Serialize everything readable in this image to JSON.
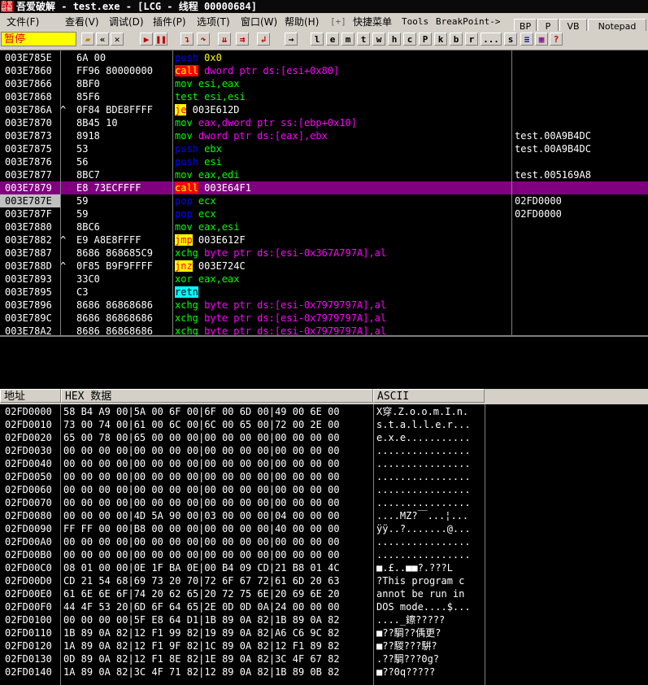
{
  "window": {
    "app_name": "吾爱破解",
    "title_rest": " - test.exe - [LCG - 线程 00000684]"
  },
  "menu": {
    "items": [
      "文件(F)",
      "查看(V)",
      "调试(D)",
      "插件(P)",
      "选项(T)",
      "窗口(W)",
      "帮助(H)",
      "[+]",
      "快捷菜单",
      "Tools",
      "BreakPoint->"
    ],
    "right_buttons": [
      "BP",
      "P",
      "VB",
      "Notepad"
    ]
  },
  "toolbar": {
    "status": "暂停",
    "letter_buttons": [
      "l",
      "e",
      "m",
      "t",
      "w",
      "h",
      "c",
      "P",
      "k",
      "b",
      "r",
      "...",
      "s"
    ]
  },
  "disassembly": {
    "selected_index": 10,
    "rows": [
      {
        "addr": "003E785E",
        "mark": "",
        "hex": "6A 00",
        "mnem": "push",
        "ops": "0x0",
        "cmt": ""
      },
      {
        "addr": "003E7860",
        "mark": "",
        "hex": "FF96 80000000",
        "mnem": "call",
        "ops": "dword ptr ds:[esi+0x80]",
        "cmt": ""
      },
      {
        "addr": "003E7866",
        "mark": "",
        "hex": "8BF0",
        "mnem": "mov",
        "ops": "esi,eax",
        "cmt": ""
      },
      {
        "addr": "003E7868",
        "mark": "",
        "hex": "85F6",
        "mnem": "test",
        "ops": "esi,esi",
        "cmt": ""
      },
      {
        "addr": "003E786A",
        "mark": "^",
        "hex": "0F84 BDE8FFFF",
        "mnem": "je",
        "ops": "003E612D",
        "cmt": ""
      },
      {
        "addr": "003E7870",
        "mark": "",
        "hex": "8B45 10",
        "mnem": "mov",
        "ops": "eax,dword ptr ss:[ebp+0x10]",
        "cmt": ""
      },
      {
        "addr": "003E7873",
        "mark": "",
        "hex": "8918",
        "mnem": "mov",
        "ops": "dword ptr ds:[eax],ebx",
        "cmt": "test.00A9B4DC"
      },
      {
        "addr": "003E7875",
        "mark": "",
        "hex": "53",
        "mnem": "push",
        "ops": "ebx",
        "cmt": "test.00A9B4DC"
      },
      {
        "addr": "003E7876",
        "mark": "",
        "hex": "56",
        "mnem": "push",
        "ops": "esi",
        "cmt": ""
      },
      {
        "addr": "003E7877",
        "mark": "",
        "hex": "8BC7",
        "mnem": "mov",
        "ops": "eax,edi",
        "cmt": "test.005169A8"
      },
      {
        "addr": "003E7879",
        "mark": "",
        "hex": "E8 73ECFFFF",
        "mnem": "call",
        "ops": "003E64F1",
        "cmt": ""
      },
      {
        "addr": "003E787E",
        "mark": "",
        "hex": "59",
        "mnem": "pop",
        "ops": "ecx",
        "cmt": "02FD0000"
      },
      {
        "addr": "003E787F",
        "mark": "",
        "hex": "59",
        "mnem": "pop",
        "ops": "ecx",
        "cmt": "02FD0000"
      },
      {
        "addr": "003E7880",
        "mark": "",
        "hex": "8BC6",
        "mnem": "mov",
        "ops": "eax,esi",
        "cmt": ""
      },
      {
        "addr": "003E7882",
        "mark": "^",
        "hex": "E9 A8E8FFFF",
        "mnem": "jmp",
        "ops": "003E612F",
        "cmt": ""
      },
      {
        "addr": "003E7887",
        "mark": "",
        "hex": "8686 868685C9",
        "mnem": "xchg",
        "ops": "byte ptr ds:[esi-0x367A797A],al",
        "cmt": ""
      },
      {
        "addr": "003E788D",
        "mark": "^",
        "hex": "0F85 B9F9FFFF",
        "mnem": "jnz",
        "ops": "003E724C",
        "cmt": ""
      },
      {
        "addr": "003E7893",
        "mark": "",
        "hex": "33C0",
        "mnem": "xor",
        "ops": "eax,eax",
        "cmt": ""
      },
      {
        "addr": "003E7895",
        "mark": "",
        "hex": "C3",
        "mnem": "retn",
        "ops": "",
        "cmt": ""
      },
      {
        "addr": "003E7896",
        "mark": "",
        "hex": "8686 86868686",
        "mnem": "xchg",
        "ops": "byte ptr ds:[esi-0x7979797A],al",
        "cmt": ""
      },
      {
        "addr": "003E789C",
        "mark": "",
        "hex": "8686 86868686",
        "mnem": "xchg",
        "ops": "byte ptr ds:[esi-0x7979797A],al",
        "cmt": ""
      },
      {
        "addr": "003E78A2",
        "mark": "",
        "hex": "8686 86868686",
        "mnem": "xchg",
        "ops": "byte ptr ds:[esi-0x7979797A],al",
        "cmt": ""
      }
    ]
  },
  "dump": {
    "headers": [
      "地址",
      "HEX 数据",
      "ASCII"
    ],
    "rows": [
      {
        "addr": "02FD0000",
        "hex": "58 B4 A9 00|5A 00 6F 00|6F 00 6D 00|49 00 6E 00",
        "ascii": "X穿.Z.o.o.m.I.n."
      },
      {
        "addr": "02FD0010",
        "hex": "73 00 74 00|61 00 6C 00|6C 00 65 00|72 00 2E 00",
        "ascii": "s.t.a.l.l.e.r..."
      },
      {
        "addr": "02FD0020",
        "hex": "65 00 78 00|65 00 00 00|00 00 00 00|00 00 00 00",
        "ascii": "e.x.e..........."
      },
      {
        "addr": "02FD0030",
        "hex": "00 00 00 00|00 00 00 00|00 00 00 00|00 00 00 00",
        "ascii": "................"
      },
      {
        "addr": "02FD0040",
        "hex": "00 00 00 00|00 00 00 00|00 00 00 00|00 00 00 00",
        "ascii": "................"
      },
      {
        "addr": "02FD0050",
        "hex": "00 00 00 00|00 00 00 00|00 00 00 00|00 00 00 00",
        "ascii": "................"
      },
      {
        "addr": "02FD0060",
        "hex": "00 00 00 00|00 00 00 00|00 00 00 00|00 00 00 00",
        "ascii": "................"
      },
      {
        "addr": "02FD0070",
        "hex": "00 00 00 00|00 00 00 00|00 00 00 00|00 00 00 00",
        "ascii": "................"
      },
      {
        "addr": "02FD0080",
        "hex": "00 00 00 00|4D 5A 90 00|03 00 00 00|04 00 00 00",
        "ascii": "....MZ?￣...¦..."
      },
      {
        "addr": "02FD0090",
        "hex": "FF FF 00 00|B8 00 00 00|00 00 00 00|40 00 00 00",
        "ascii": "ÿÿ..?.......@..."
      },
      {
        "addr": "02FD00A0",
        "hex": "00 00 00 00|00 00 00 00|00 00 00 00|00 00 00 00",
        "ascii": "................"
      },
      {
        "addr": "02FD00B0",
        "hex": "00 00 00 00|00 00 00 00|00 00 00 00|00 00 00 00",
        "ascii": "................"
      },
      {
        "addr": "02FD00C0",
        "hex": "08 01 00 00|0E 1F BA 0E|00 B4 09 CD|21 B8 01 4C",
        "ascii": "■.£..■■?.???L"
      },
      {
        "addr": "02FD00D0",
        "hex": "CD 21 54 68|69 73 20 70|72 6F 67 72|61 6D 20 63",
        "ascii": "?This program c"
      },
      {
        "addr": "02FD00E0",
        "hex": "61 6E 6E 6F|74 20 62 65|20 72 75 6E|20 69 6E 20",
        "ascii": "annot be run in "
      },
      {
        "addr": "02FD00F0",
        "hex": "44 4F 53 20|6D 6F 64 65|2E 0D 0D 0A|24 00 00 00",
        "ascii": "DOS mode....$..."
      },
      {
        "addr": "02FD0100",
        "hex": "00 00 00 00|5F E8 64 D1|1B 89 0A 82|1B 89 0A 82",
        "ascii": "...._鑔?????"
      },
      {
        "addr": "02FD0110",
        "hex": "1B 89 0A 82|12 F1 99 82|19 89 0A 82|A6 C6 9C 82",
        "ascii": "■??騆??偊更?"
      },
      {
        "addr": "02FD0120",
        "hex": "1A 89 0A 82|12 F1 9F 82|1C 89 0A 82|12 F1 89 82",
        "ascii": "■??騣???騈?"
      },
      {
        "addr": "02FD0130",
        "hex": "0D 89 0A 82|12 F1 8E 82|1E 89 0A 82|3C 4F 67 82",
        "ascii": ".??騆???0g?"
      },
      {
        "addr": "02FD0140",
        "hex": "1A 89 0A 82|3C 4F 71 82|12 89 0A 82|1B 89 0B 82",
        "ascii": "■??0q?????"
      }
    ]
  }
}
